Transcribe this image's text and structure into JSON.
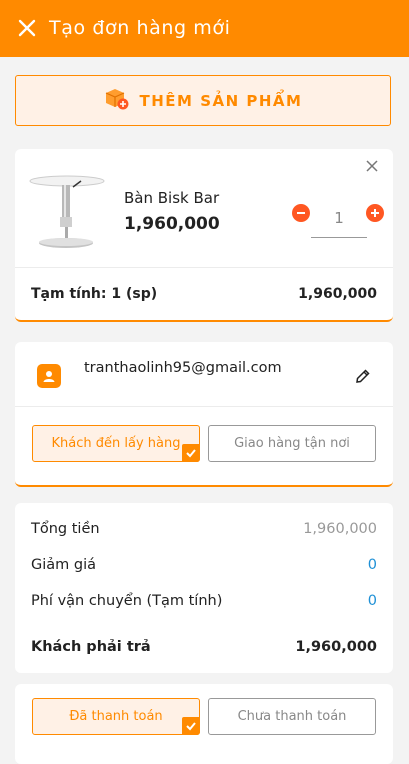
{
  "header": {
    "title": "Tạo đơn hàng mới",
    "close_icon": "close-icon"
  },
  "add_product": {
    "label": "THÊM SẢN PHẨM",
    "icon": "box-add-icon"
  },
  "product": {
    "name": "Bàn Bisk Bar",
    "price": "1,960,000",
    "quantity": "1",
    "subtotal_label": "Tạm tính: 1 (sp)",
    "subtotal_value": "1,960,000"
  },
  "customer": {
    "email": "tranthaolinh95@gmail.com",
    "pickup_label": "Khách đến lấy hàng",
    "delivery_label": "Giao hàng tận nơi",
    "selected": "pickup"
  },
  "summary": {
    "total_label": "Tổng tiền",
    "total_value": "1,960,000",
    "discount_label": "Giảm giá",
    "discount_value": "0",
    "shipping_label": "Phí vận chuyển (Tạm tính)",
    "shipping_value": "0",
    "pay_label": "Khách phải trả",
    "pay_value": "1,960,000"
  },
  "payment": {
    "paid_label": "Đã thanh toán",
    "unpaid_label": "Chưa thanh toán",
    "selected": "paid"
  },
  "colors": {
    "accent": "#ff8a00",
    "accent_light": "#fff1e6",
    "link_blue": "#1e90d6",
    "minus_plus": "#ff5722"
  }
}
